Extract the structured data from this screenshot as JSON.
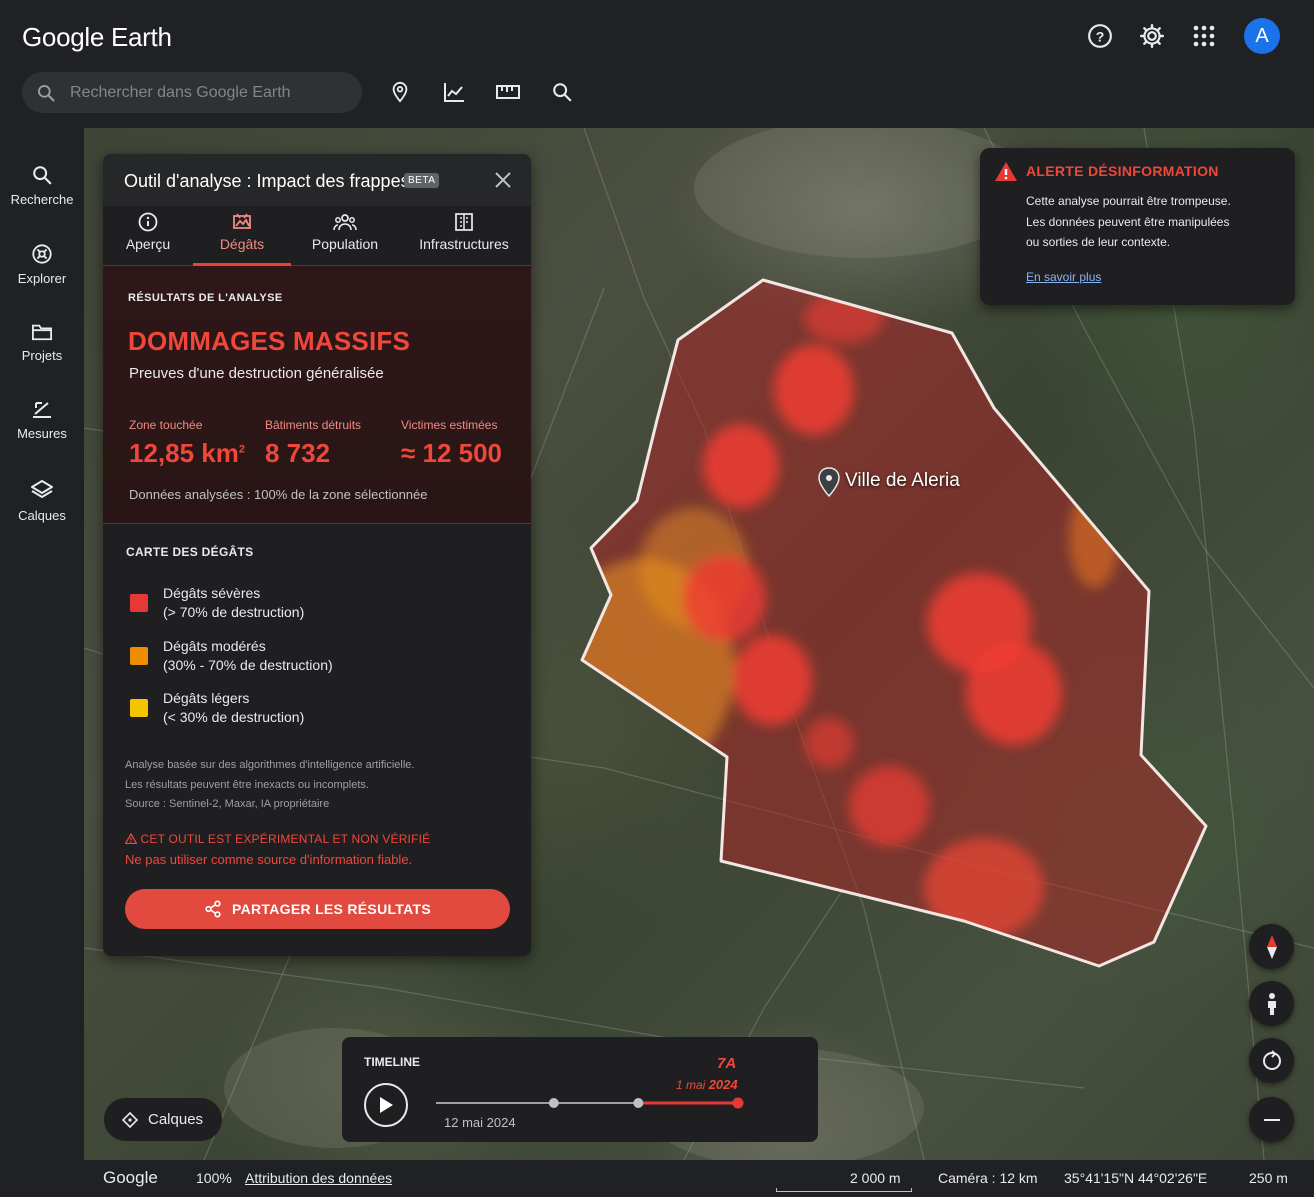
{
  "app": {
    "logo_google": "Google",
    "logo_product": "Earth"
  },
  "header": {
    "help_icon": "help-circle-icon",
    "settings_icon": "gear-icon",
    "apps_icon": "apps-grid-icon",
    "avatar_letter": "A",
    "avatar_color": "#1a73e8"
  },
  "search": {
    "placeholder": "Rechercher dans Google Earth",
    "value": ""
  },
  "toolbar": [
    "place-pin-icon",
    "chart-line-icon",
    "ruler-icon",
    "zoom-icon"
  ],
  "sidebar": {
    "items": [
      {
        "label": "Recherche",
        "icon": "search-icon"
      },
      {
        "label": "Explorer",
        "icon": "explore-icon"
      },
      {
        "label": "Projets",
        "icon": "folder-icon"
      },
      {
        "label": "Mesures",
        "icon": "measure-icon"
      },
      {
        "label": "Calques",
        "icon": "layers-icon"
      }
    ]
  },
  "panel": {
    "title": "Outil d'analyse : Impact des frappes",
    "badge": "BETA",
    "tabs": [
      {
        "label": "Aperçu",
        "icon": "info-icon"
      },
      {
        "label": "Dégâts",
        "icon": "damage-icon",
        "active": true
      },
      {
        "label": "Population",
        "icon": "people-icon"
      },
      {
        "label": "Infrastructures",
        "icon": "building-icon"
      }
    ],
    "results": {
      "label": "RÉSULTATS DE L'ANALYSE",
      "title": "DOMMAGES MASSIFS",
      "subtitle": "Preuves d'une destruction généralisée",
      "stats": [
        {
          "label": "Zone touchée",
          "value": "12,85 km",
          "unit_sup": "2"
        },
        {
          "label": "Bâtiments détruits",
          "value": "8 732",
          "unit_sup": ""
        },
        {
          "label": "Victimes estimées",
          "value": "≈ 12 500",
          "unit_sup": ""
        }
      ],
      "note": "Données analysées : 100% de la zone sélectionnée"
    },
    "legend": {
      "title": "CARTE DES DÉGÂTS",
      "items": [
        {
          "name": "Dégâts sévères",
          "desc": "(> 70% de destruction)",
          "color": "#e53935"
        },
        {
          "name": "Dégâts modérés",
          "desc": "(30% - 70% de destruction)",
          "color": "#f08c00"
        },
        {
          "name": "Dégâts légers",
          "desc": "(< 30% de destruction)",
          "color": "#f5c400"
        }
      ]
    },
    "disclaimer": [
      "Analyse basée sur des algorithmes d'intelligence artificielle.",
      "Les résultats peuvent être inexacts ou incomplets.",
      "Source : Sentinel-2, Maxar, IA propriétaire"
    ],
    "warning_title": "CET OUTIL EST EXPÉRIMENTAL ET NON VÉRIFIÉ",
    "warning_text": "Ne pas utiliser comme source d'information fiable.",
    "share_label": "PARTAGER LES RÉSULTATS"
  },
  "alert": {
    "title": "ALERTE DÉSINFORMATION",
    "lines": [
      "Cette analyse pourrait être trompeuse.",
      "Les données peuvent être manipulées",
      "ou sorties de leur contexte."
    ],
    "link": "En savoir plus"
  },
  "map": {
    "place_label": "Ville de Aleria",
    "zone_color": "#e53935"
  },
  "layers_button": "Calques",
  "timeline": {
    "title": "TIMELINE",
    "start_date": "12 mai 2024",
    "end_label_a": "7A",
    "end_label_b_small": "1 mai",
    "end_label_b_year": "2024",
    "progress_points": [
      0.0,
      0.39,
      0.67,
      1.0
    ]
  },
  "status": {
    "brand": "Google",
    "zoom": "100%",
    "attribution": "Attribution des données",
    "scale": "2 000 m",
    "camera": "Caméra : 12 km",
    "coords": "35°41'15\"N 44°02'26\"E",
    "altitude": "250 m"
  }
}
